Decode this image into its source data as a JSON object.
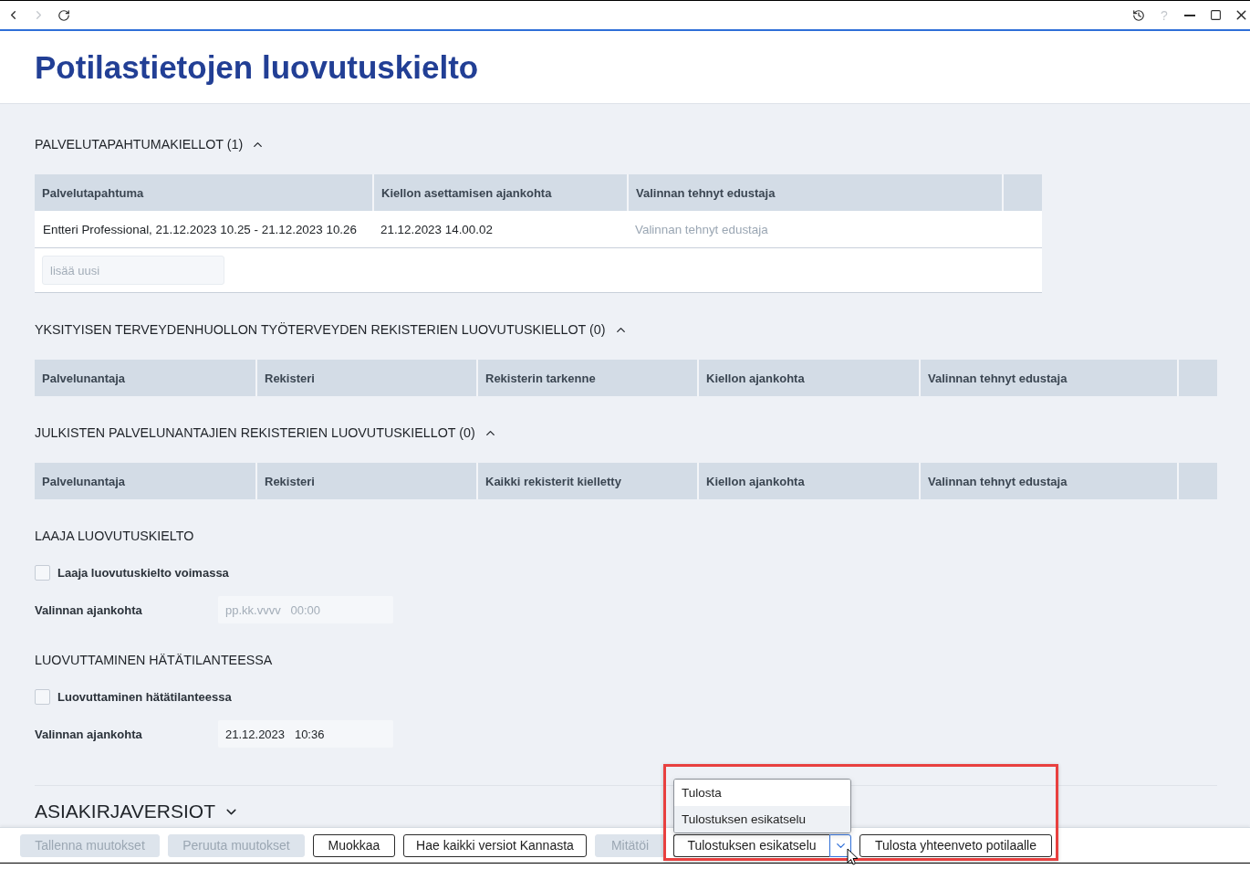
{
  "browser_bar": {
    "navigation": [
      {
        "kind": "back",
        "disabled": false
      },
      {
        "kind": "forward",
        "disabled": true
      },
      {
        "kind": "reload",
        "disabled": false
      }
    ],
    "window_controls": [
      {
        "kind": "history",
        "disabled": false
      },
      {
        "kind": "help",
        "label": "?",
        "disabled": true
      },
      {
        "kind": "minimize",
        "disabled": false
      },
      {
        "kind": "maximize",
        "disabled": false
      },
      {
        "kind": "close",
        "disabled": false
      }
    ]
  },
  "page": {
    "title": "Potilastietojen luovutuskielto"
  },
  "sections": [
    {
      "kind": "table",
      "title": "PALVELUTAPAHTUMAKIELLOT (1)",
      "expanded": true,
      "columns": [
        "Palvelutapahtuma",
        "Kiellon asettamisen ajankohta",
        "Valinnan tehnyt edustaja"
      ],
      "rows": [
        {
          "cells": [
            {
              "value": "Entteri Professional, 21.12.2023 10.25 - 21.12.2023 10.26"
            },
            {
              "value": "21.12.2023 14.00.02"
            },
            {
              "placeholder": "Valinnan tehnyt edustaja"
            }
          ]
        }
      ],
      "add_field": {
        "placeholder": "lisää uusi"
      }
    },
    {
      "kind": "table",
      "title": "YKSITYISEN TERVEYDENHUOLLON TYÖTERVEYDEN REKISTERIEN LUOVUTUSKIELLOT (0)",
      "expanded": true,
      "columns": [
        "Palvelunantaja",
        "Rekisteri",
        "Rekisterin tarkenne",
        "Kiellon ajankohta",
        "Valinnan tehnyt edustaja"
      ]
    },
    {
      "kind": "table",
      "title": "JULKISTEN PALVELUNANTAJIEN REKISTERIEN LUOVUTUSKIELLOT (0)",
      "expanded": true,
      "columns": [
        "Palvelunantaja",
        "Rekisteri",
        "Kaikki rekisterit kielletty",
        "Kiellon ajankohta",
        "Valinnan tehnyt edustaja"
      ]
    },
    {
      "kind": "form",
      "title": "LAAJA LUOVUTUSKIELTO",
      "checkbox": {
        "label": "Laaja luovutuskielto voimassa",
        "checked": false
      },
      "field": {
        "label": "Valinnan ajankohta",
        "placeholder": "pp.kk.vvvv   00:00"
      }
    },
    {
      "kind": "form",
      "title": "LUOVUTTAMINEN HÄTÄTILANTEESSA",
      "checkbox": {
        "label": "Luovuttaminen hätätilanteessa",
        "checked": false
      },
      "field": {
        "label": "Valinnan ajankohta",
        "value": "21.12.2023   10:36"
      }
    },
    {
      "kind": "group",
      "title": "ASIAKIRJAVERSIOT",
      "expanded": false
    }
  ],
  "footer_buttons": [
    {
      "kind": "button",
      "label": "Tallenna muutokset",
      "disabled": true
    },
    {
      "kind": "button",
      "label": "Peruuta muutokset",
      "disabled": true
    },
    {
      "kind": "button",
      "label": "Muokkaa",
      "disabled": false
    },
    {
      "kind": "button",
      "label": "Hae kaikki versiot Kannasta",
      "disabled": false
    },
    {
      "kind": "button",
      "label": "Mitätöi",
      "disabled": true
    },
    {
      "kind": "split",
      "label": "Tulostuksen esikatselu",
      "disabled": false,
      "expanded": true,
      "focused": true,
      "menu": [
        {
          "label": "Tulosta",
          "selected": false
        },
        {
          "label": "Tulostuksen esikatselu",
          "selected": true
        }
      ]
    },
    {
      "kind": "button",
      "label": "Tulosta yhteenveto potilaalle",
      "disabled": false
    }
  ]
}
